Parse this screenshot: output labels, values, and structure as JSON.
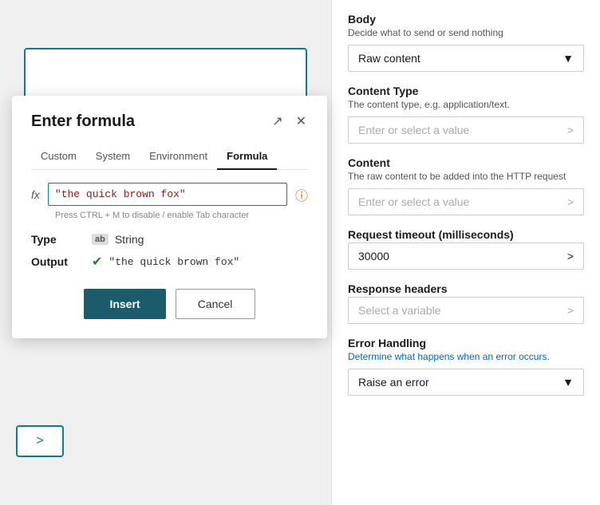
{
  "modal": {
    "title": "Enter formula",
    "tabs": [
      {
        "label": "Custom",
        "id": "custom",
        "active": false
      },
      {
        "label": "System",
        "id": "system",
        "active": false
      },
      {
        "label": "Environment",
        "id": "environment",
        "active": false
      },
      {
        "label": "Formula",
        "id": "formula",
        "active": true
      }
    ],
    "fx_label": "fx",
    "formula_value": "\"the quick brown fox\"",
    "ctrl_hint": "Press CTRL + M to disable / enable Tab character",
    "type_label": "Type",
    "type_icon": "ab",
    "type_value": "String",
    "output_label": "Output",
    "output_value": "\"the quick brown fox\"",
    "insert_btn": "Insert",
    "cancel_btn": "Cancel",
    "expand_icon": "↗",
    "close_icon": "✕"
  },
  "right_panel": {
    "body_label": "Body",
    "body_desc": "Decide what to send or send nothing",
    "body_selected": "Raw content",
    "content_type_label": "Content Type",
    "content_type_desc": "The content type, e.g. application/text.",
    "content_type_placeholder": "Enter or select a value",
    "content_label": "Content",
    "content_desc": "The raw content to be added into the HTTP request",
    "content_placeholder": "Enter or select a value",
    "timeout_label": "Request timeout (milliseconds)",
    "timeout_value": "30000",
    "response_headers_label": "Response headers",
    "response_headers_placeholder": "Select a variable",
    "error_handling_label": "Error Handling",
    "error_handling_desc": "Determine what happens when an error occurs.",
    "error_handling_selected": "Raise an error"
  }
}
